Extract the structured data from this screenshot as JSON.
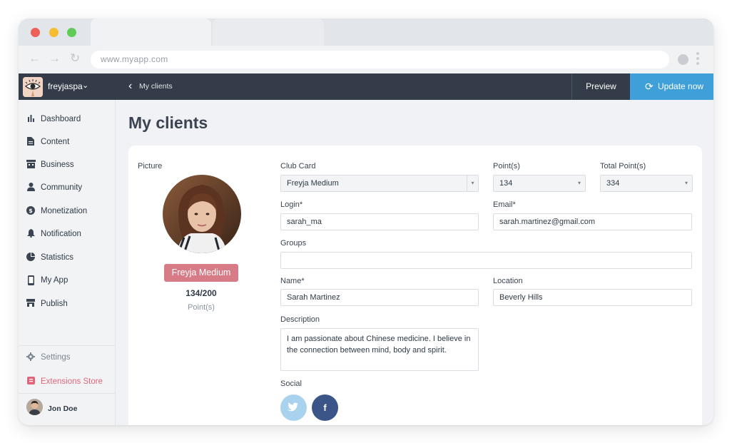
{
  "browser": {
    "url": "www.myapp.com",
    "nav": {
      "back": "←",
      "forward": "→",
      "reload": "↻"
    }
  },
  "appbar": {
    "brand_name": "freyjaspa",
    "brand_caret": "⌄",
    "back_icon": "‹",
    "back_label": "My clients",
    "preview_label": "Preview",
    "update_label": "Update now",
    "update_icon": "⟳",
    "update_color": "#3f9fd8"
  },
  "sidebar": {
    "items": [
      {
        "label": "Dashboard",
        "icon": "bar-chart-icon",
        "glyph": "▐"
      },
      {
        "label": "Content",
        "icon": "document-icon",
        "glyph": "▤"
      },
      {
        "label": "Business",
        "icon": "storefront-icon",
        "glyph": "▦"
      },
      {
        "label": "Community",
        "icon": "person-icon",
        "glyph": "●"
      },
      {
        "label": "Monetization",
        "icon": "dollar-icon",
        "glyph": "$"
      },
      {
        "label": "Notification",
        "icon": "bell-icon",
        "glyph": "▲"
      },
      {
        "label": "Statistics",
        "icon": "pie-chart-icon",
        "glyph": "◔"
      },
      {
        "label": "My App",
        "icon": "phone-icon",
        "glyph": "▯"
      },
      {
        "label": "Publish",
        "icon": "shop-icon",
        "glyph": "▀"
      }
    ],
    "settings_label": "Settings",
    "settings_glyph": "✲",
    "extensions_label": "Extensions Store",
    "extensions_glyph": "▣",
    "user_name": "Jon Doe"
  },
  "main": {
    "title": "My clients",
    "picture_label": "Picture",
    "badge": "Freyja Medium",
    "points_value": "134/200",
    "points_label": "Point(s)",
    "club_card": {
      "label": "Club Card",
      "value": "Freyja Medium"
    },
    "points": {
      "label": "Point(s)",
      "value": "134"
    },
    "total_points": {
      "label": "Total Point(s)",
      "value": "334"
    },
    "login": {
      "label": "Login*",
      "value": "sarah_ma"
    },
    "email": {
      "label": "Email*",
      "value": "sarah.martinez@gmail.com"
    },
    "groups": {
      "label": "Groups",
      "value": ""
    },
    "name": {
      "label": "Name*",
      "value": "Sarah Martinez"
    },
    "location": {
      "label": "Location",
      "value": "Beverly Hills"
    },
    "description": {
      "label": "Description",
      "value": "I am passionate about Chinese medicine. I believe in the connection between mind, body and spirit."
    },
    "social": {
      "label": "Social",
      "twitter_glyph": "t",
      "facebook_glyph": "f"
    }
  }
}
